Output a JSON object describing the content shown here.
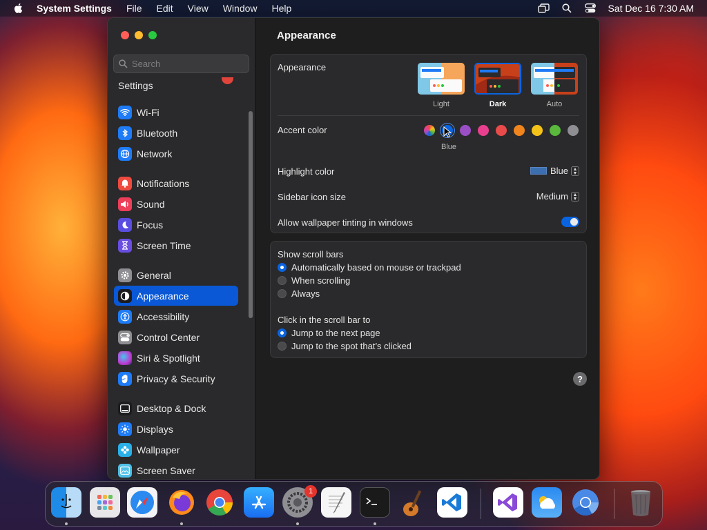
{
  "menubar": {
    "app_name": "System Settings",
    "menus": [
      "File",
      "Edit",
      "View",
      "Window",
      "Help"
    ],
    "clock": "Sat Dec 16  7:30 AM"
  },
  "sidebar": {
    "search_placeholder": "Search",
    "partial_item": "Settings",
    "items": [
      {
        "label": "Wi-Fi",
        "icon": "wifi-icon",
        "color": "#1f7bf6"
      },
      {
        "label": "Bluetooth",
        "icon": "bluetooth-icon",
        "color": "#1f7bf6"
      },
      {
        "label": "Network",
        "icon": "globe-icon",
        "color": "#1f7bf6"
      },
      {
        "label": "Notifications",
        "icon": "bell-icon",
        "color": "#ee4a3f"
      },
      {
        "label": "Sound",
        "icon": "speaker-icon",
        "color": "#ee3f5a"
      },
      {
        "label": "Focus",
        "icon": "moon-icon",
        "color": "#5a4ee0"
      },
      {
        "label": "Screen Time",
        "icon": "hourglass-icon",
        "color": "#6a4ee0"
      },
      {
        "label": "General",
        "icon": "gear-icon",
        "color": "#8e8e93"
      },
      {
        "label": "Appearance",
        "icon": "appearance-icon",
        "color": "#1c1c1e"
      },
      {
        "label": "Accessibility",
        "icon": "accessibility-icon",
        "color": "#1f7bf6"
      },
      {
        "label": "Control Center",
        "icon": "control-center-icon",
        "color": "#8e8e93"
      },
      {
        "label": "Siri & Spotlight",
        "icon": "siri-icon",
        "color": "#c13ad0"
      },
      {
        "label": "Privacy & Security",
        "icon": "hand-icon",
        "color": "#1f7bf6"
      },
      {
        "label": "Desktop & Dock",
        "icon": "dock-icon",
        "color": "#1c1c1e"
      },
      {
        "label": "Displays",
        "icon": "sun-icon",
        "color": "#1f7bf6"
      },
      {
        "label": "Wallpaper",
        "icon": "flower-icon",
        "color": "#2ab0e8"
      },
      {
        "label": "Screen Saver",
        "icon": "screensaver-icon",
        "color": "#4ec0e8"
      }
    ],
    "selected": "Appearance"
  },
  "content": {
    "title": "Appearance",
    "appearance": {
      "label": "Appearance",
      "options": [
        "Light",
        "Dark",
        "Auto"
      ],
      "selected": "Dark"
    },
    "accent": {
      "label": "Accent color",
      "colors": [
        "multicolor",
        "#0a64e0",
        "#9b4fc4",
        "#e8408f",
        "#e94b4b",
        "#f0841d",
        "#f5c218",
        "#5ab83c",
        "#8e8e93"
      ],
      "selected_caption": "Blue"
    },
    "highlight": {
      "label": "Highlight color",
      "value": "Blue",
      "swatch": "#3c6fb0"
    },
    "icon_size": {
      "label": "Sidebar icon size",
      "value": "Medium"
    },
    "tinting": {
      "label": "Allow wallpaper tinting in windows",
      "on": true
    },
    "scroll_bars": {
      "title": "Show scroll bars",
      "options": [
        "Automatically based on mouse or trackpad",
        "When scrolling",
        "Always"
      ],
      "selected": 0
    },
    "click_scroll": {
      "title": "Click in the scroll bar to",
      "options": [
        "Jump to the next page",
        "Jump to the spot that’s clicked"
      ],
      "selected": 0
    },
    "help": "?"
  },
  "dock": {
    "apps": [
      "Finder",
      "Launchpad",
      "Safari",
      "Firefox",
      "Chrome",
      "App Store",
      "System Settings",
      "TextEdit",
      "Terminal",
      "GarageBand",
      "Visual Studio Code",
      "Visual Studio",
      "Weather",
      "Chromium",
      "Trash"
    ],
    "settings_badge": "1"
  }
}
